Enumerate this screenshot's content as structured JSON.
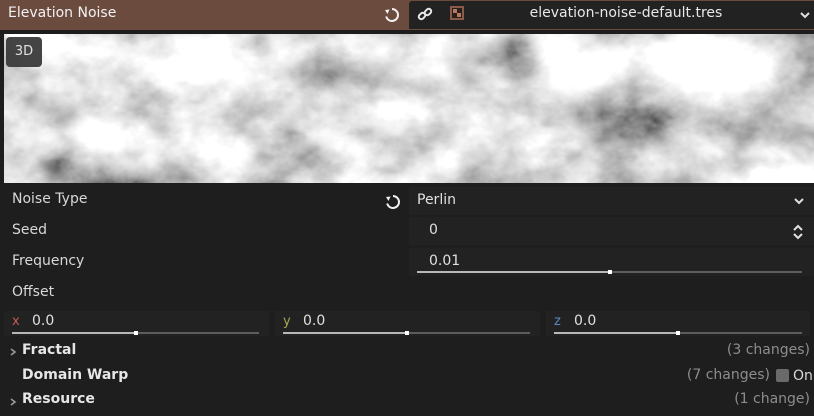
{
  "header": {
    "title": "Elevation Noise",
    "resource_name": "elevation-noise-default.tres"
  },
  "preview": {
    "view_mode_label": "3D"
  },
  "properties": {
    "noise_type": {
      "label": "Noise Type",
      "value": "Perlin"
    },
    "seed": {
      "label": "Seed",
      "value": "0"
    },
    "frequency": {
      "label": "Frequency",
      "value": "0.01",
      "slider_fraction": 0.5
    },
    "offset": {
      "label": "Offset",
      "x": {
        "axis": "x",
        "value": "0.0",
        "slider_fraction": 0.5,
        "color": "#c35a5a"
      },
      "y": {
        "axis": "y",
        "value": "0.0",
        "slider_fraction": 0.5,
        "color": "#a3a84e"
      },
      "z": {
        "axis": "z",
        "value": "0.0",
        "slider_fraction": 0.5,
        "color": "#5d86c4"
      }
    }
  },
  "sections": {
    "fractal": {
      "label": "Fractal",
      "changes": "(3 changes)"
    },
    "domain_warp": {
      "label": "Domain Warp",
      "changes": "(7 changes)",
      "toggle_label": "On"
    },
    "resource": {
      "label": "Resource",
      "changes": "(1 change)"
    }
  },
  "icons": {
    "revert": "revert-icon",
    "link": "link-icon",
    "resource": "noise-texture-icon",
    "dropdown": "chevron-down-icon",
    "stepper": "up-down-stepper-icon",
    "expand": "chevron-right-icon"
  },
  "colors": {
    "header_bg": "#6b4b3e",
    "panel_bg": "#1e1e1e",
    "field_bg": "#222222"
  }
}
